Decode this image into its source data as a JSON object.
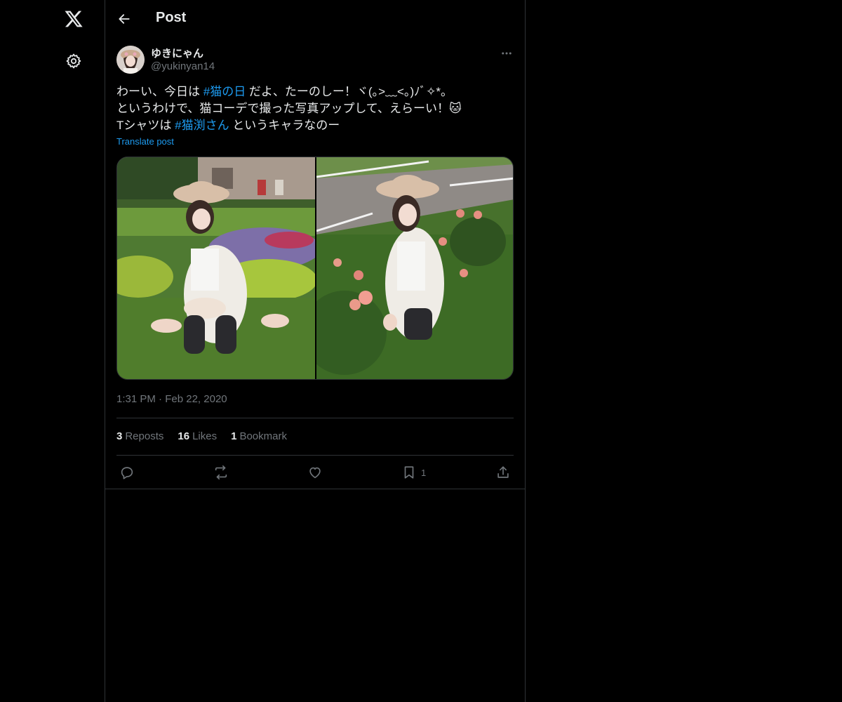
{
  "left_rail": {
    "logo_icon": "x-logo-icon",
    "settings_icon": "gear-icon"
  },
  "header": {
    "title": "Post"
  },
  "post": {
    "author": {
      "display_name": "ゆきにゃん",
      "handle": "@yukinyan14"
    },
    "text_lines": [
      [
        {
          "text": "わーい、今日は "
        },
        {
          "text": "#猫の日",
          "hashtag": true
        },
        {
          "text": " だよ、たーのしー！ヾ(｡>﹏<｡)ﾉﾞ✧*。"
        }
      ],
      [
        {
          "text": "というわけで、猫コーデで撮った写真アップして、えらーい！🐱"
        }
      ],
      [
        {
          "text": "Tシャツは "
        },
        {
          "text": "#猫渕さん",
          "hashtag": true
        },
        {
          "text": " というキャラなのー"
        }
      ]
    ],
    "translate_label": "Translate post",
    "time": "1:31 PM",
    "separator": "·",
    "date": "Feb 22, 2020",
    "stats": {
      "reposts_count": "3",
      "reposts_label": "Reposts",
      "likes_count": "16",
      "likes_label": "Likes",
      "bookmarks_count": "1",
      "bookmarks_label": "Bookmark"
    },
    "actions": {
      "bookmark_count": "1"
    }
  },
  "colors": {
    "background": "#000000",
    "text": "#e7e9ea",
    "secondary_text": "#71767b",
    "accent": "#1d9bf0",
    "border": "#2f3336"
  }
}
